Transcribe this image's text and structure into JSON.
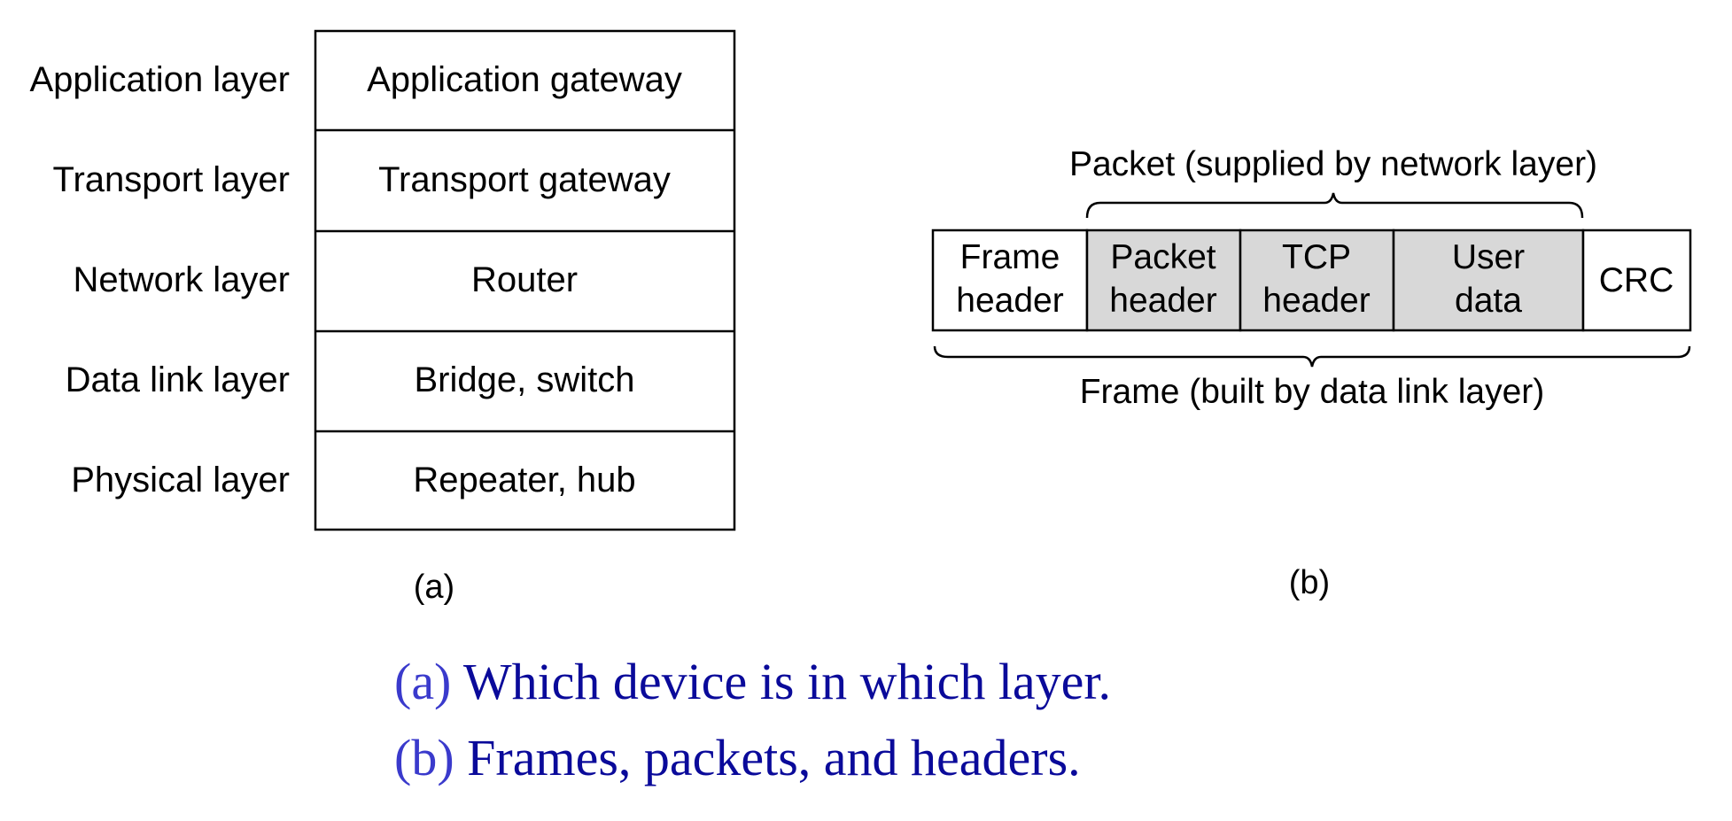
{
  "figure_a": {
    "label": "(a)",
    "rows": [
      {
        "layer": "Application layer",
        "device": "Application gateway"
      },
      {
        "layer": "Transport layer",
        "device": "Transport gateway"
      },
      {
        "layer": "Network layer",
        "device": "Router"
      },
      {
        "layer": "Data link layer",
        "device": "Bridge, switch"
      },
      {
        "layer": "Physical layer",
        "device": "Repeater, hub"
      }
    ]
  },
  "figure_b": {
    "label": "(b)",
    "packet_brace_label": "Packet (supplied by network layer)",
    "frame_brace_label": "Frame (built by data link layer)",
    "cells": [
      {
        "lines": [
          "Frame",
          "header"
        ],
        "shaded": false
      },
      {
        "lines": [
          "Packet",
          "header"
        ],
        "shaded": true
      },
      {
        "lines": [
          "TCP",
          "header"
        ],
        "shaded": true
      },
      {
        "lines": [
          "User",
          "data"
        ],
        "shaded": true
      },
      {
        "lines": [
          "CRC"
        ],
        "shaded": false
      }
    ],
    "colors": {
      "shaded_fill": "#d8d8d8",
      "plain_fill": "#ffffff",
      "stroke": "#000000"
    }
  },
  "captions": [
    {
      "prefix": "(a)",
      "text": " Which device is in which layer."
    },
    {
      "prefix": "(b)",
      "text": " Frames, packets, and headers."
    }
  ],
  "caption_colors": {
    "prefix": "#3a3acc",
    "text": "#0a0a9a"
  }
}
